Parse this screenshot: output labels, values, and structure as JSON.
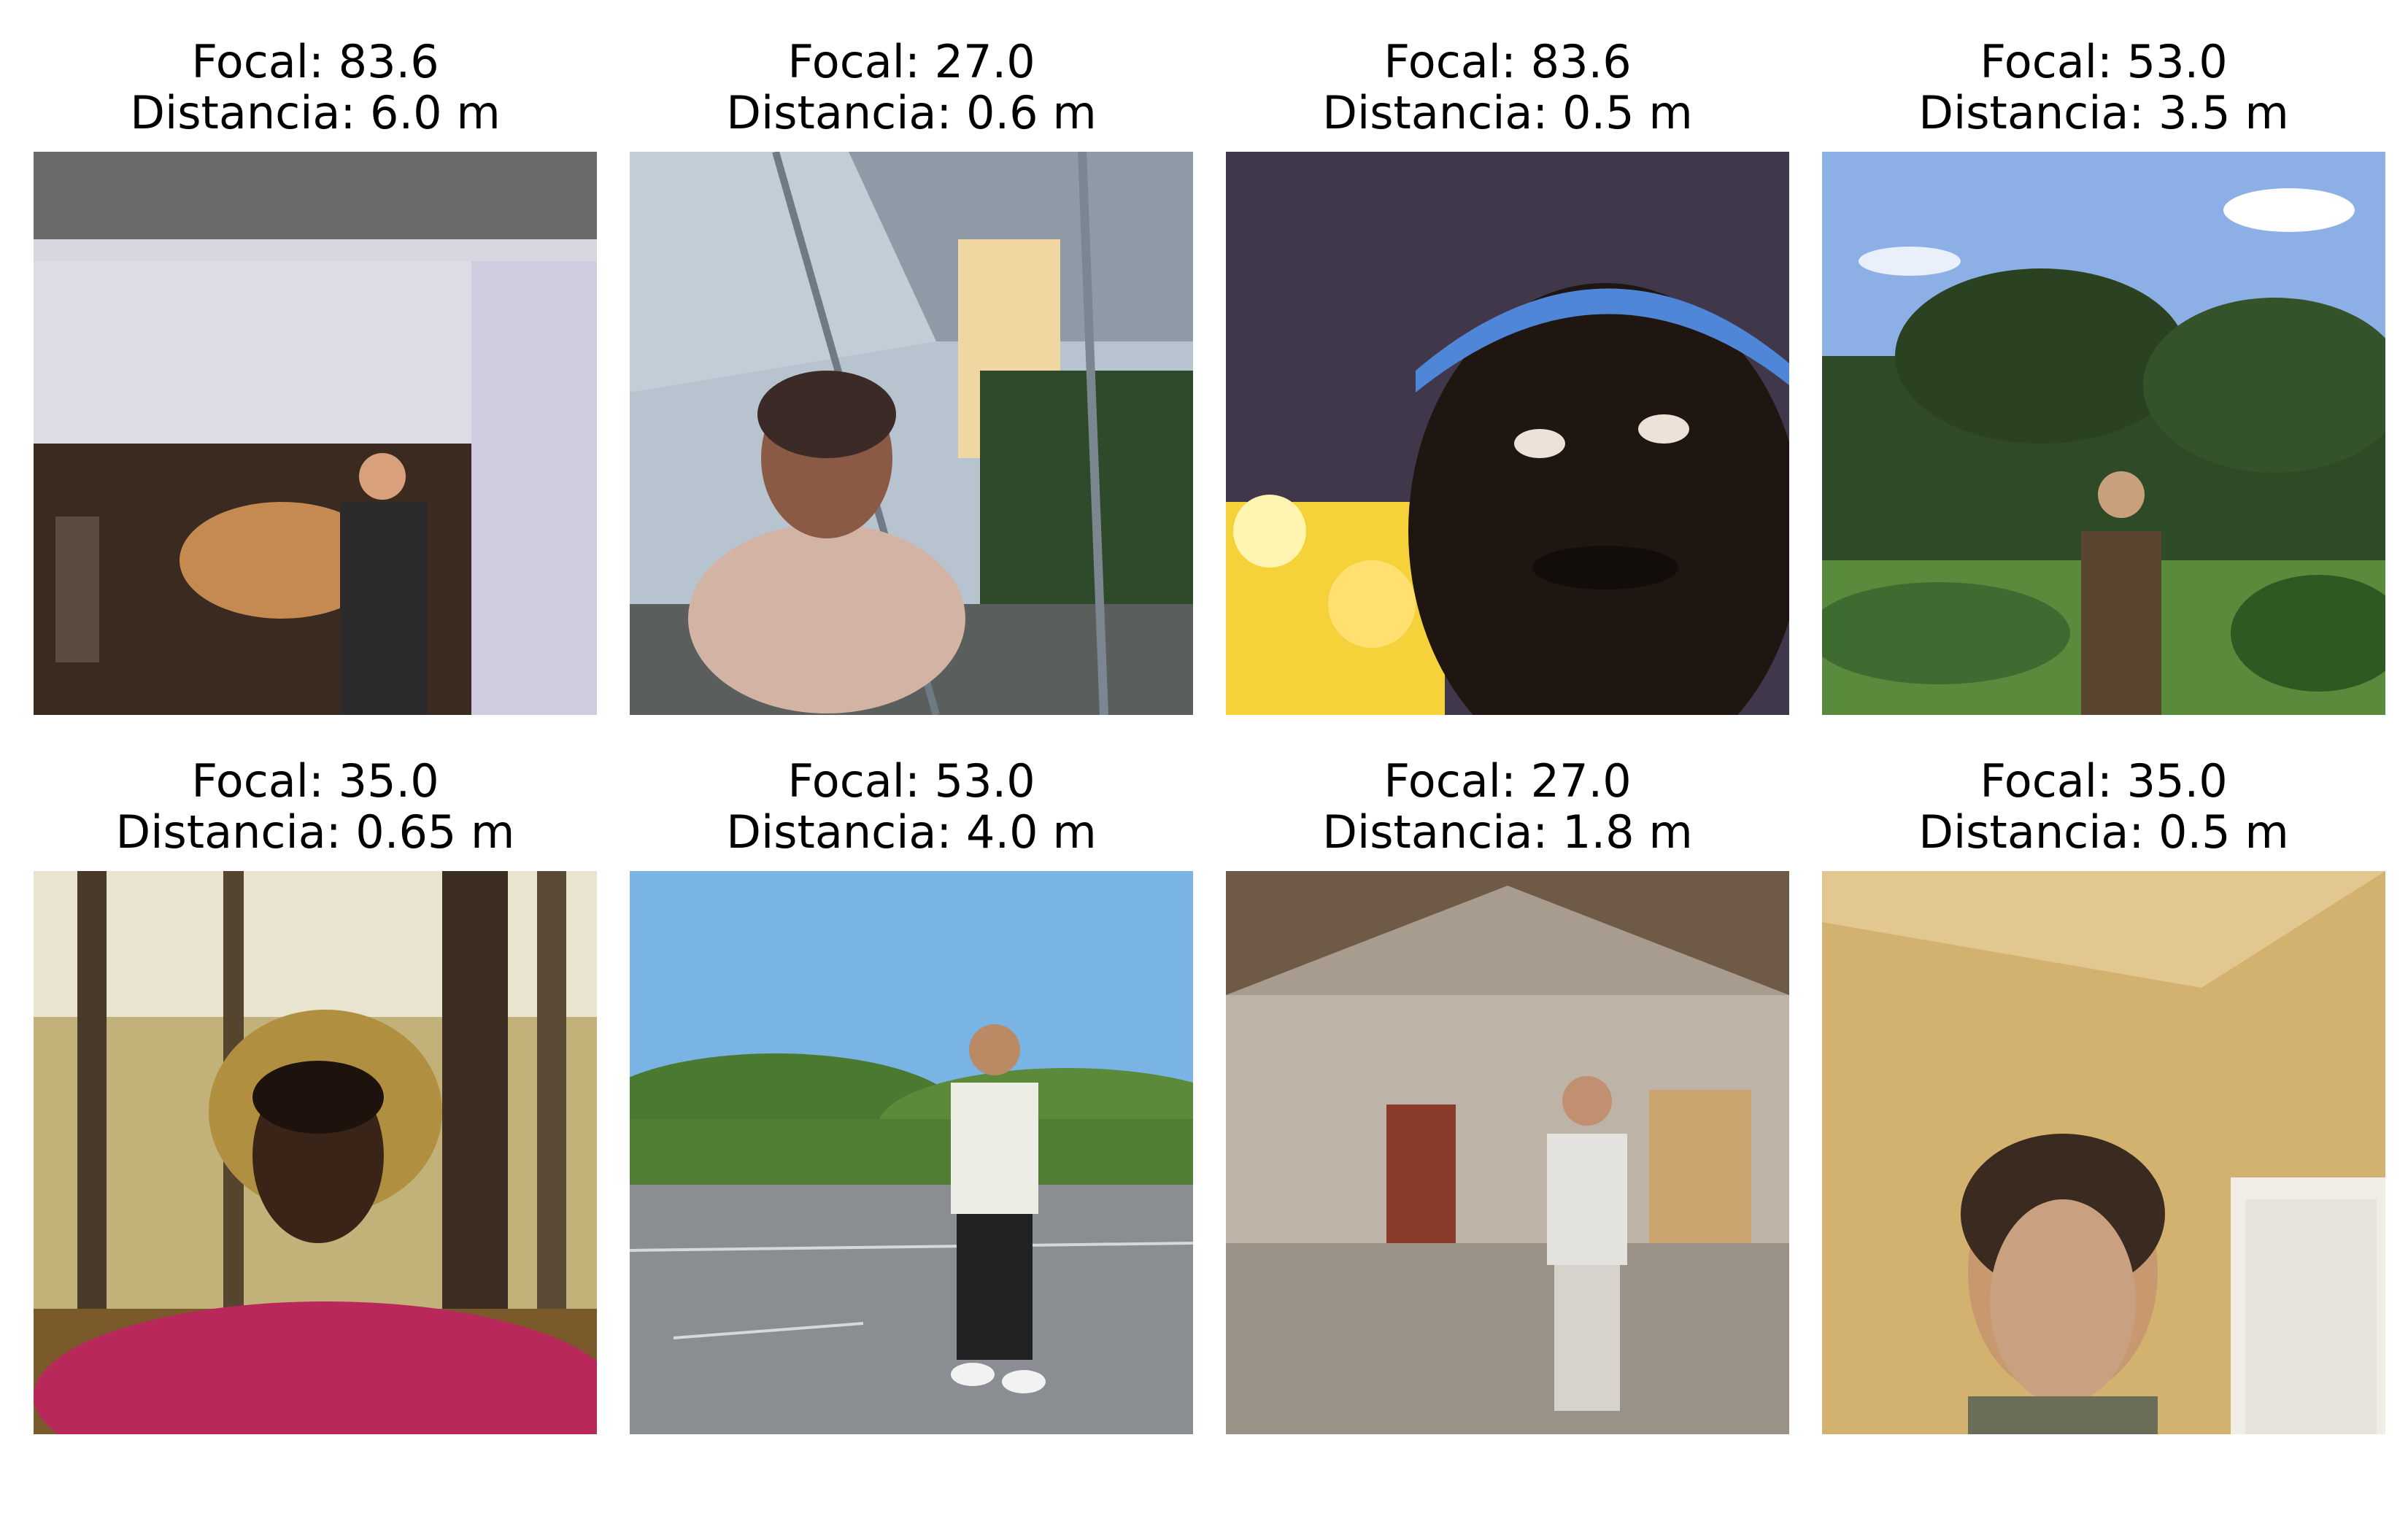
{
  "panels": [
    {
      "focal": "Focal: 83.6",
      "distance": "Distancia: 6.0 m",
      "scene": "indoor-lobby",
      "person": "man-in-suit-standing",
      "bg_color": "#d8d4e0",
      "accent": "#5a3a25"
    },
    {
      "focal": "Focal: 27.0",
      "distance": "Distancia: 0.6 m",
      "scene": "glass-greenhouse-corridor",
      "person": "woman-close-up",
      "bg_color": "#9fb0c0",
      "accent": "#c9ada0"
    },
    {
      "focal": "Focal: 83.6",
      "distance": "Distancia: 0.5 m",
      "scene": "night-city-lights",
      "person": "man-face-close-up-headband",
      "bg_color": "#3d3346",
      "accent": "#4f86d8"
    },
    {
      "focal": "Focal: 53.0",
      "distance": "Distancia: 3.5 m",
      "scene": "park-with-trees",
      "person": "man-standing-vest",
      "bg_color": "#7fa6e0",
      "accent": "#2c4a22"
    },
    {
      "focal": "Focal: 35.0",
      "distance": "Distancia: 0.65 m",
      "scene": "autumn-forest",
      "person": "woman-selfie-pink-shirt",
      "bg_color": "#b9a66b",
      "accent": "#b8285a"
    },
    {
      "focal": "Focal: 53.0",
      "distance": "Distancia: 4.0 m",
      "scene": "parking-lot-with-trees",
      "person": "man-standing-white-tshirt",
      "bg_color": "#7ab4e4",
      "accent": "#2a2a2a"
    },
    {
      "focal": "Focal: 27.0",
      "distance": "Distancia: 1.8 m",
      "scene": "barn-interior",
      "person": "man-standing-white-outfit",
      "bg_color": "#a89c8f",
      "accent": "#8a3b2a"
    },
    {
      "focal": "Focal: 35.0",
      "distance": "Distancia: 0.5 m",
      "scene": "beige-room-corner",
      "person": "woman-face-close-up",
      "bg_color": "#c9a865",
      "accent": "#6a4a35"
    }
  ]
}
